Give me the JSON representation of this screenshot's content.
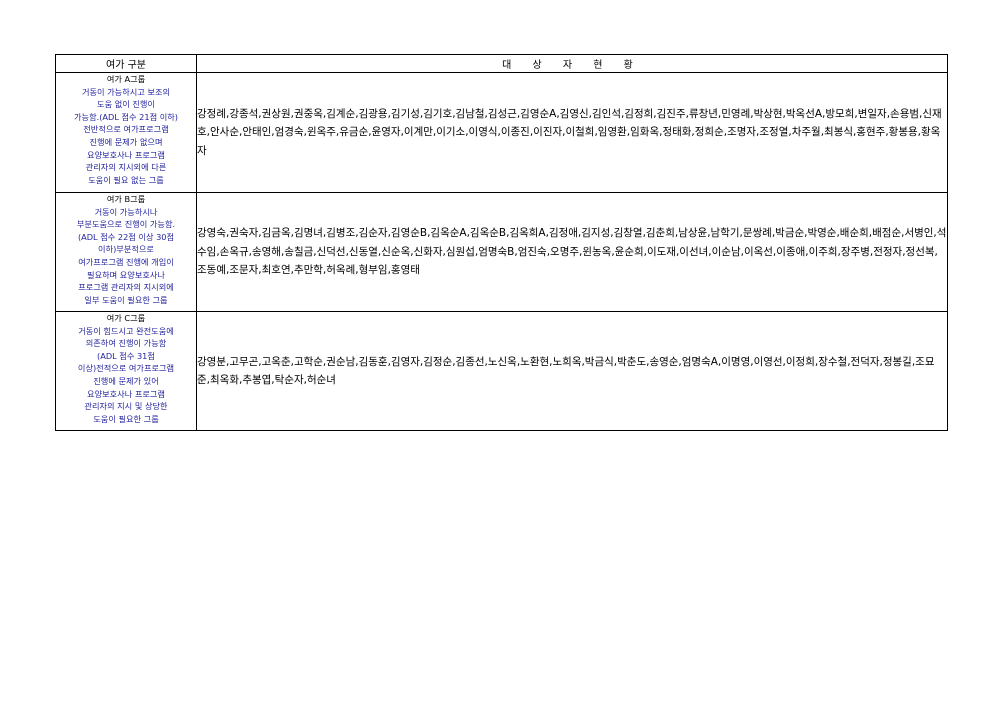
{
  "table": {
    "headers": [
      "여가 구분",
      "대 상 자 현 황"
    ],
    "rows": [
      {
        "group": "여가 A그룹",
        "description": "거동이 가능하시고 보조의\n도움 없이 진행이\n가능함.(ADL 점수 21점 이하)\n전반적으로 여가프로그램\n진행에 문제가 없으며\n요양보호사나 프로그램\n관리자의 지시외에 다른\n도움이 필요 없는 그룹",
        "names": "강정례,강종석,권상원,권중옥,김계순,김광용,김기성,김기호,김남철,김성근,김영순A,김영신,김인석,김정희,김진주,류창년,민영례,박상현,박옥선A,방모희,변일자,손용범,신재호,안사순,안태인,엄경숙,윈옥주,유금순,윤영자,이계만,이기소,이영식,이종진,이진자,이철희,임영환,임화옥,정태화,정희순,조명자,조정열,차주월,최봉식,홍현주,황봉용,황옥자"
      },
      {
        "group": "여가 B그룹",
        "description": "거동이 가능하시나\n부분도움으로 진행이 가능함.\n(ADL 점수 22점 이상 30점\n이하)부분적으로\n여가프로그램 진행에 개입이\n필요하며 요양보호사나\n프로그램 관리자의 지시외에\n일부 도움이 필요한 그룹",
        "names": "강영숙,권숙자,김금옥,김명녀,김병조,김순자,김영순B,김옥순A,김옥순B,김옥희A,김정애,김지성,김창열,김춘희,남상윤,남학기,문쌍례,박금순,박영순,배순희,배점순,서병인,석수임,손옥규,송영해,송칠금,신덕선,신동열,신순옥,신화자,심원섭,엄명숙B,엄진숙,오명주,윈농옥,윤순희,이도재,이선녀,이순남,이옥선,이종애,이주희,장주병,전정자,정선복,조동예,조문자,최호연,추만학,허옥례,형부임,홍영태"
      },
      {
        "group": "여가 C그룹",
        "description": "거동이 힘드시고 완전도움에\n의존하여 진행이 가능함\n(ADL 점수 31점\n이상)전적으로 여가프로그램\n진행에 문제가 있어\n요양보호사나 프로그램\n관리자의 지시 및 상당한\n도움이 필요한 그룹",
        "names": "강영분,고무곤,고옥춘,고학순,권순남,김동훈,김영자,김정순,김종선,노신옥,노환현,노희옥,박금식,박춘도,송영순,엄명숙A,이명영,이영선,이정희,장수철,전덕자,정봉길,조묘준,최옥화,추봉엽,탁순자,허순녀"
      }
    ]
  }
}
